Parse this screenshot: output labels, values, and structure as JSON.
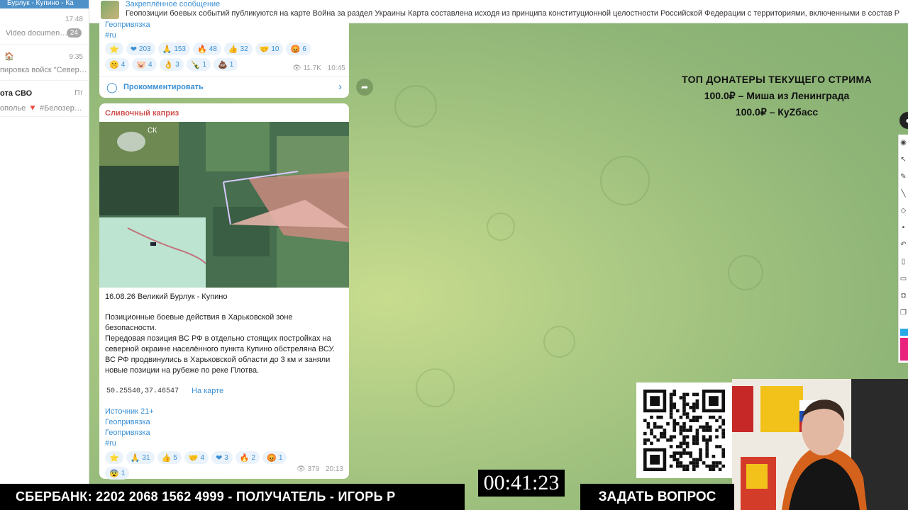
{
  "chat_list": {
    "top_text": "Бурлук - Купино - Ка",
    "items": [
      {
        "name": "",
        "preview": "Video documen…",
        "time": "17:48",
        "badge": "24"
      },
      {
        "name": "🏠",
        "preview": "пировка войск \"Север…",
        "time": "9:35",
        "badge": ""
      },
      {
        "name": "ота СВО",
        "preview": "ополье 🔻 #Белозер…",
        "time": "Пт",
        "badge": ""
      }
    ]
  },
  "pinned": {
    "title": "Закреплённое сообщение",
    "text": "Геопозиции боевых событий публикуются на карте   Война за раздел Украины  Карта составлена исходя из принципа конституционной целостности Российской Федерации с территориями, включенными в состав Р"
  },
  "message1": {
    "tags": [
      "Геопривязка",
      "#ru"
    ],
    "reactions": [
      {
        "icon": "⭐",
        "count": ""
      },
      {
        "icon": "❤",
        "count": "203"
      },
      {
        "icon": "🙏",
        "count": "153"
      },
      {
        "icon": "🔥",
        "count": "48"
      },
      {
        "icon": "👍",
        "count": "32"
      },
      {
        "icon": "🤝",
        "count": "10"
      },
      {
        "icon": "😡",
        "count": "6"
      },
      {
        "icon": "🤫",
        "count": "4"
      },
      {
        "icon": "🐷",
        "count": "4"
      },
      {
        "icon": "👌",
        "count": "3"
      },
      {
        "icon": "🍾",
        "count": "1"
      },
      {
        "icon": "💩",
        "count": "1"
      }
    ],
    "views": "11.7K",
    "time": "10:45",
    "comment_label": "Прокомментировать"
  },
  "message2": {
    "author": "Сливочный каприз",
    "date_line": "16.08.26 Великий Бурлук - Купино",
    "paragraph1": "Позиционные боевые действия в Харьковской зоне безопасности.",
    "paragraph2": "Передовая позиция ВС РФ в отдельно стоящих постройках на северной окраине населённого пункта Купино обстреляна ВСУ.",
    "paragraph3": "ВС РФ продвинулись в Харьковской области до 3 км и заняли новые позиции на рубеже по реке Плотва.",
    "coords": "50.25540,37.46547",
    "map_link": "На карте",
    "tags": [
      "Источник 21+",
      "Геопривязка",
      "Геопривязка",
      "#ru"
    ],
    "reactions": [
      {
        "icon": "⭐",
        "count": ""
      },
      {
        "icon": "🙏",
        "count": "31"
      },
      {
        "icon": "👍",
        "count": "5"
      },
      {
        "icon": "🤝",
        "count": "4"
      },
      {
        "icon": "❤",
        "count": "3"
      },
      {
        "icon": "🔥",
        "count": "2"
      },
      {
        "icon": "😡",
        "count": "1"
      },
      {
        "icon": "😨",
        "count": "1"
      }
    ],
    "views": "379",
    "time": "20:13",
    "map_label": "СК"
  },
  "stream": {
    "donors_title": "ТОП ДОНАТЕРЫ ТЕКУЩЕГО СТРИМА",
    "donor1": "100.0₽ – Миша из Ленинграда",
    "donor2": "100.0₽ – КуZбасс",
    "timer": "00:41:23",
    "banner": "СБЕРБАНК: 2202 2068 1562 4999 - ПОЛУЧАТЕЛЬ - ИГОРЬ Р",
    "ask": "ЗАДАТЬ ВОПРОС"
  }
}
